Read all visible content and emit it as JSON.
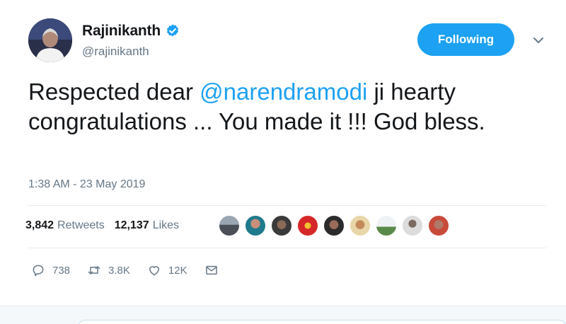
{
  "author": {
    "display_name": "Rajinikanth",
    "handle": "@rajinikanth",
    "verified_icon": "verified-badge-icon"
  },
  "follow_button": {
    "label": "Following"
  },
  "menu": {
    "icon": "chevron-down-icon"
  },
  "tweet": {
    "text_before": "Respected dear ",
    "mention": "@narendramodi",
    "text_after": " ji hearty congratulations ... You made it !!! God bless."
  },
  "timestamp": "1:38 AM - 23 May 2019",
  "stats": {
    "retweets_count": "3,842",
    "retweets_label": "Retweets",
    "likes_count": "12,137",
    "likes_label": "Likes"
  },
  "likers_icon": "liker-avatar",
  "actions": {
    "reply_count": "738",
    "retweet_count": "3.8K",
    "like_count": "12K"
  },
  "colors": {
    "accent": "#1da1f2",
    "text_primary": "#14171a",
    "text_secondary": "#657786",
    "divider": "#e6ecf0"
  }
}
